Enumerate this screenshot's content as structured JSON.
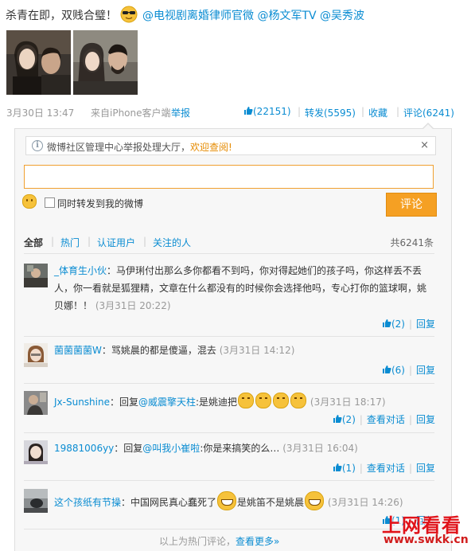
{
  "post": {
    "text": "杀青在即，双贱合璧！",
    "mentions": [
      "@电视剧离婚律师官微",
      "@杨文军TV",
      "@吴秀波"
    ],
    "emoji": "cool-sunglasses-emoji",
    "images": [
      "photo-1",
      "photo-2"
    ]
  },
  "meta": {
    "time": "3月30日 13:47",
    "source": "来自iPhone客户端",
    "report": "举报",
    "likes": "(22151)",
    "repost": "转发(5595)",
    "favorite": "收藏",
    "comment": "评论(6241)"
  },
  "notice": {
    "text": "微博社区管理中心举报处理大厅，",
    "link": "欢迎查阅!",
    "close": "×"
  },
  "composer": {
    "input_value": "",
    "repost_label": "同时转发到我的微博",
    "submit_label": "评论"
  },
  "tabs": {
    "items": [
      "全部",
      "热门",
      "认证用户",
      "关注的人"
    ],
    "total": "共6241条"
  },
  "comments": [
    {
      "user": "_体育生小伙",
      "text": "：马伊琍付出那么多你都看不到吗，你对得起她们的孩子吗，你这样丢不丢人，你一看就是狐狸精，文章在什么都没有的时候你会选择他吗，专心打你的篮球啊，姚贝娜！！",
      "time": "(3月31日 20:22)",
      "likes": "(2)",
      "reply": "回复",
      "view": ""
    },
    {
      "user": "菌菌菌菌W",
      "text": "：骂姚晨的都是傻逼，混去",
      "time": "(3月31日 14:12)",
      "likes": "(6)",
      "reply": "回复",
      "view": ""
    },
    {
      "user": "Jx-Sunshine",
      "text_pre": "：回复",
      "mention": "@威震擎天柱",
      "text_post": ":是姚迪把",
      "time": "(3月31日 18:17)",
      "likes": "(2)",
      "reply": "回复",
      "view": "查看对话"
    },
    {
      "user": "19881006yy",
      "text_pre": "：回复",
      "mention": "@叫我小崔啦",
      "text_post": ":你是来搞笑的么…",
      "time": "(3月31日 16:04)",
      "likes": "(1)",
      "reply": "回复",
      "view": "查看对话"
    },
    {
      "user": "这个孩纸有节操",
      "text_pre": "：中国网民真心蠢死了",
      "text_mid": "是姚笛不是姚晨",
      "time": "(3月31日 14:26)",
      "likes": "(1)",
      "reply": "回复",
      "view": ""
    }
  ],
  "footer": {
    "text": "以上为热门评论，",
    "link": "查看更多»"
  },
  "watermark": {
    "top": "上网看看",
    "bottom": "www.swkk.cn"
  },
  "colors": {
    "link": "#0a8cd2",
    "accent": "#f5a023",
    "watermark": "#e0131a"
  }
}
